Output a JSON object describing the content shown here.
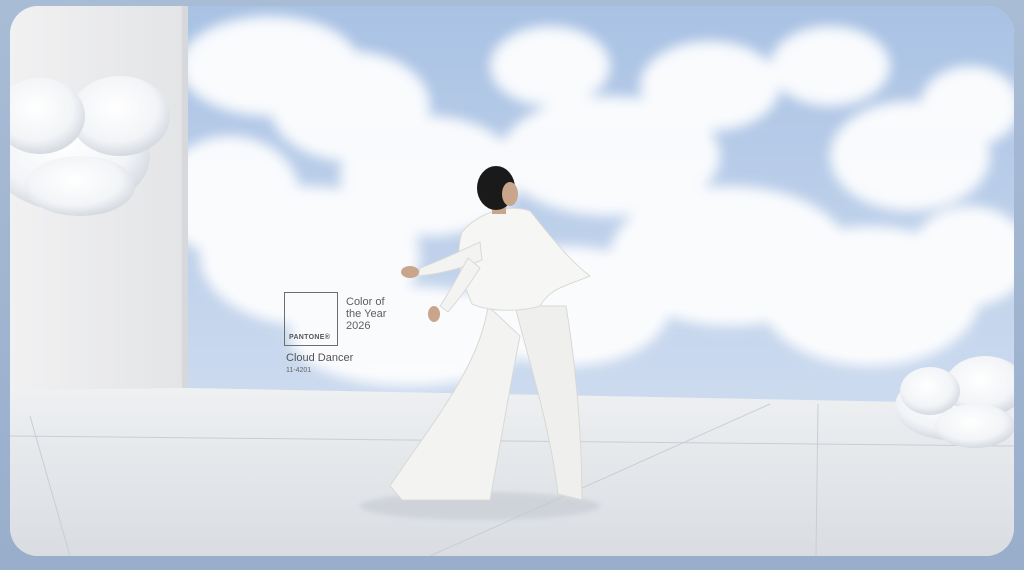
{
  "image": {
    "description": "Pantone Color of the Year 2026 campaign image: a figure in a white suit posing on a white floor against a sky full of clouds, with cotton-like clouds floating at the edges.",
    "pantone": {
      "brand": "PANTONE",
      "registered_mark": "®",
      "headline_lines": [
        "Color of",
        "the Year",
        "2026"
      ],
      "color_name": "Cloud Dancer",
      "color_code": "11-4201"
    },
    "colors": {
      "frame": "#9fb3cf",
      "sky": "#b9cde6",
      "floor": "#e6e8ea",
      "wall": "#ececee",
      "outfit": "#f2f2f0",
      "hair": "#1a1a1a"
    }
  }
}
